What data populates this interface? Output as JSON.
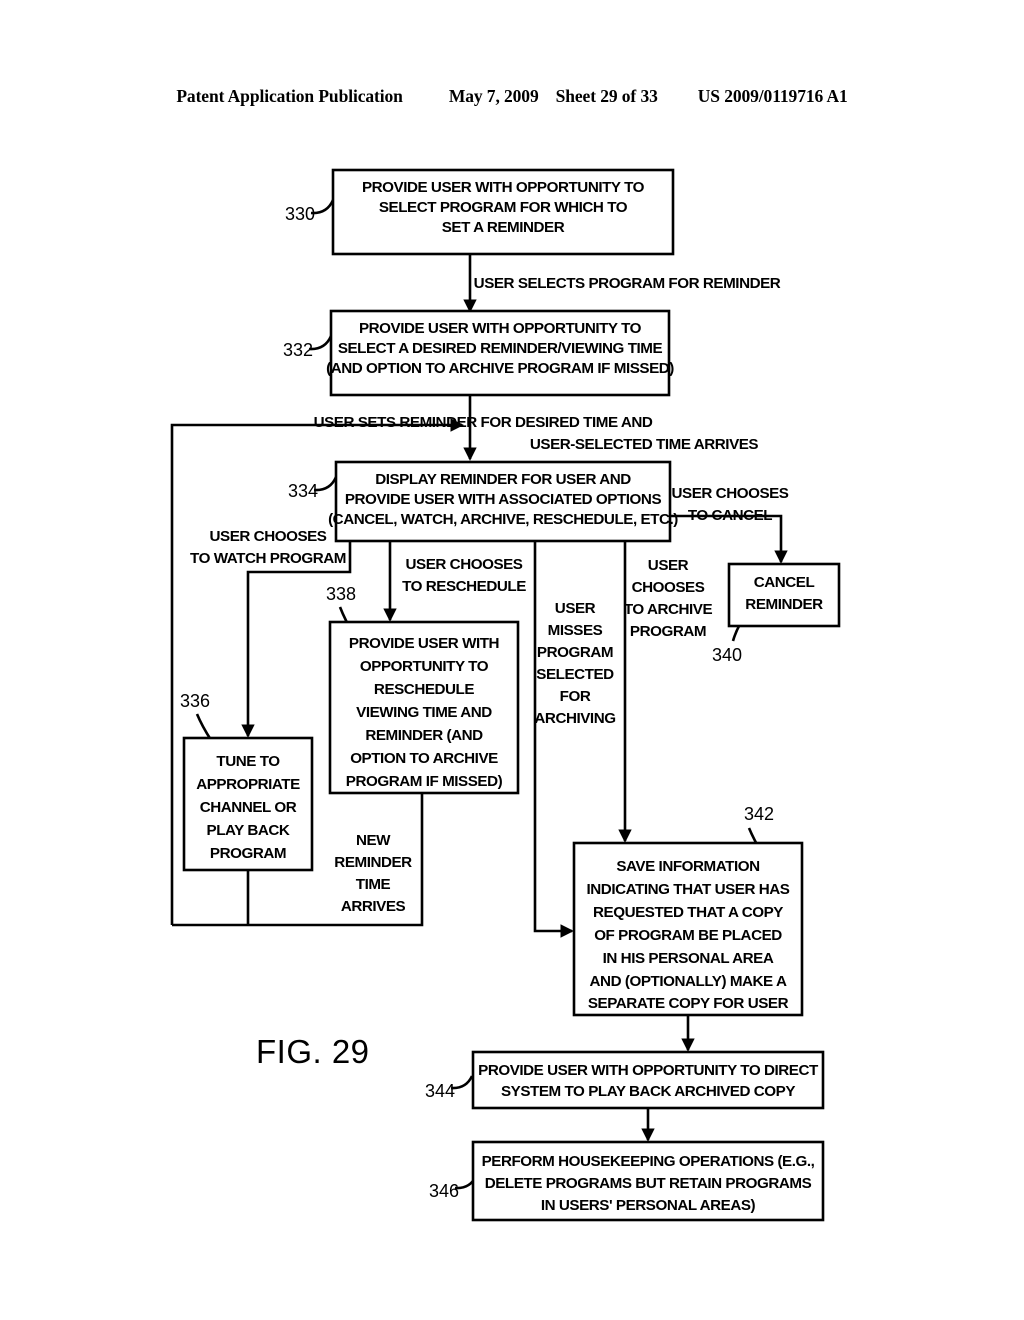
{
  "header": {
    "title": "Patent Application Publication",
    "date": "May 7, 2009",
    "sheet": "Sheet 29 of 33",
    "publication_number": "US 2009/0119716 A1"
  },
  "figure": {
    "label": "FIG. 29"
  },
  "boxes": {
    "b330": {
      "ref": "330",
      "lines": [
        "PROVIDE USER WITH OPPORTUNITY TO",
        "SELECT PROGRAM FOR WHICH TO",
        "SET A REMINDER"
      ]
    },
    "b332": {
      "ref": "332",
      "lines": [
        "PROVIDE USER WITH OPPORTUNITY TO",
        "SELECT A DESIRED REMINDER/VIEWING TIME",
        "(AND OPTION TO ARCHIVE PROGRAM IF MISSED)"
      ]
    },
    "b334": {
      "ref": "334",
      "lines": [
        "DISPLAY REMINDER FOR USER AND",
        "PROVIDE USER WITH ASSOCIATED OPTIONS",
        "(CANCEL, WATCH, ARCHIVE, RESCHEDULE, ETC.)"
      ]
    },
    "b336": {
      "ref": "336",
      "lines": [
        "TUNE TO",
        "APPROPRIATE",
        "CHANNEL OR",
        "PLAY BACK",
        "PROGRAM"
      ]
    },
    "b338": {
      "ref": "338",
      "lines": [
        "PROVIDE USER WITH",
        "OPPORTUNITY TO",
        "RESCHEDULE",
        "VIEWING TIME AND",
        "REMINDER (AND",
        "OPTION TO ARCHIVE",
        "PROGRAM IF MISSED)"
      ]
    },
    "b340": {
      "ref": "340",
      "lines": [
        "CANCEL",
        "REMINDER"
      ]
    },
    "b342": {
      "ref": "342",
      "lines": [
        "SAVE INFORMATION",
        "INDICATING THAT USER HAS",
        "REQUESTED THAT A COPY",
        "OF PROGRAM BE PLACED",
        "IN HIS PERSONAL AREA",
        "AND (OPTIONALLY) MAKE A",
        "SEPARATE COPY FOR USER"
      ]
    },
    "b344": {
      "ref": "344",
      "lines": [
        "PROVIDE USER WITH OPPORTUNITY TO DIRECT",
        "SYSTEM TO PLAY BACK ARCHIVED COPY"
      ]
    },
    "b346": {
      "ref": "346",
      "lines": [
        "PERFORM HOUSEKEEPING OPERATIONS (E.G.,",
        "DELETE PROGRAMS BUT RETAIN PROGRAMS",
        "IN USERS' PERSONAL AREAS)"
      ]
    }
  },
  "edge_labels": {
    "e_select": {
      "lines": [
        "USER SELECTS PROGRAM FOR REMINDER"
      ]
    },
    "e_sets": {
      "lines": [
        "USER SETS REMINDER FOR DESIRED TIME AND",
        "USER-SELECTED TIME ARRIVES"
      ]
    },
    "e_watch": {
      "lines": [
        "USER CHOOSES",
        "TO WATCH PROGRAM"
      ]
    },
    "e_reschedule": {
      "lines": [
        "USER CHOOSES",
        "TO RESCHEDULE"
      ]
    },
    "e_cancel": {
      "lines": [
        "USER CHOOSES",
        "TO CANCEL"
      ]
    },
    "e_archive": {
      "lines": [
        "USER",
        "CHOOSES",
        "TO ARCHIVE",
        "PROGRAM"
      ]
    },
    "e_misses": {
      "lines": [
        "USER",
        "MISSES",
        "PROGRAM",
        "SELECTED",
        "FOR",
        "ARCHIVING"
      ]
    },
    "e_newtime": {
      "lines": [
        "NEW",
        "REMINDER",
        "TIME",
        "ARRIVES"
      ]
    }
  }
}
